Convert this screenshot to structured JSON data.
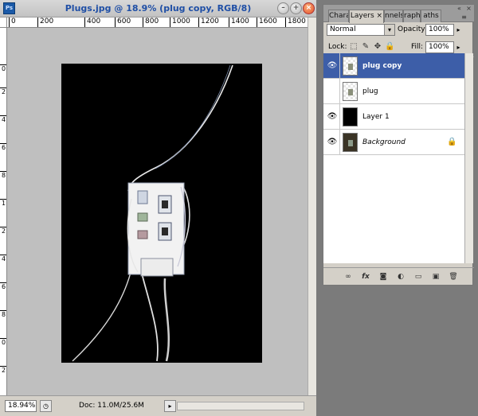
{
  "document": {
    "title": "Plugs.jpg @ 18.9% (plug copy, RGB/8)",
    "app_badge": "Ps",
    "window_buttons": [
      "minimize-icon",
      "maximize-icon",
      "close-icon"
    ],
    "ruler_top": [
      "0",
      "200",
      "400",
      "600",
      "800",
      "1000",
      "1200",
      "1400",
      "1600",
      "1800"
    ],
    "ruler_left": [
      "0",
      "2",
      "4",
      "6",
      "8",
      "1",
      "2",
      "4",
      "6",
      "8",
      "0",
      "2"
    ],
    "zoom": "18.94%",
    "doc_info": "Doc: 11.0M/25.6M"
  },
  "panel": {
    "tabs": [
      "Chara",
      "Layers",
      "nnels",
      "raph",
      "aths"
    ],
    "active_tab": "Layers",
    "blend_mode": "Normal",
    "opacity_label": "Opacity:",
    "opacity_value": "100%",
    "lock_label": "Lock:",
    "fill_label": "Fill:",
    "fill_value": "100%",
    "layers": [
      {
        "name": "plug copy",
        "visible": true,
        "selected": true,
        "thumb": "transparent"
      },
      {
        "name": "plug",
        "visible": false,
        "selected": false,
        "thumb": "transparent"
      },
      {
        "name": "Layer 1",
        "visible": true,
        "selected": false,
        "thumb": "black"
      },
      {
        "name": "Background",
        "visible": true,
        "selected": false,
        "thumb": "photo",
        "locked": true
      }
    ],
    "footer_icons": [
      "link-icon",
      "fx-icon",
      "mask-icon",
      "adjustment-icon",
      "group-folder-icon",
      "new-layer-icon",
      "trash-icon"
    ]
  },
  "colors": {
    "selected_layer": "#3d5ea8",
    "title_text": "#1f4fa6",
    "canvas_bg": "#bfbfbf",
    "workspace": "#7b7b7b"
  }
}
